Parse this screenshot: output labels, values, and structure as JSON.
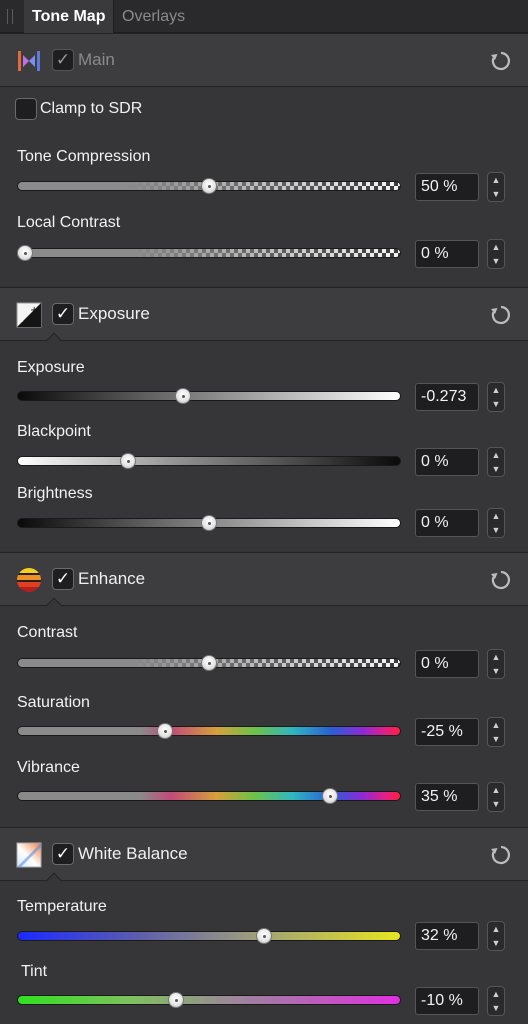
{
  "tabs": {
    "active": "Tone Map",
    "inactive": "Overlays"
  },
  "main": {
    "title": "Main",
    "check": "✓",
    "clamp_label": "Clamp to SDR",
    "tone_compression": {
      "label": "Tone Compression",
      "value": "50 %",
      "level": 0.5
    },
    "local_contrast": {
      "label": "Local Contrast",
      "value": "0 %",
      "level": 0.0
    }
  },
  "exposure": {
    "title": "Exposure",
    "check": "✓",
    "exposure": {
      "label": "Exposure",
      "value": "-0.273",
      "level": 0.43
    },
    "blackpoint": {
      "label": "Blackpoint",
      "value": "0 %",
      "level": 0.28
    },
    "brightness": {
      "label": "Brightness",
      "value": "0 %",
      "level": 0.5
    }
  },
  "enhance": {
    "title": "Enhance",
    "check": "✓",
    "contrast": {
      "label": "Contrast",
      "value": "0 %",
      "level": 0.5
    },
    "saturation": {
      "label": "Saturation",
      "value": "-25 %",
      "level": 0.38
    },
    "vibrance": {
      "label": "Vibrance",
      "value": "35 %",
      "level": 0.83
    }
  },
  "white_balance": {
    "title": "White Balance",
    "check": "✓",
    "temperature": {
      "label": "Temperature",
      "value": "32 %",
      "level": 0.65
    },
    "tint": {
      "label": "Tint",
      "value": "-10 %",
      "level": 0.41
    }
  },
  "stepper": {
    "up": "▲",
    "down": "▼"
  },
  "icons": [
    "hdr-icon",
    "exposure-icon",
    "enhance-icon",
    "white-balance-icon",
    "reset-icon",
    "checkmark-icon",
    "stepper-up-icon",
    "stepper-down-icon"
  ]
}
